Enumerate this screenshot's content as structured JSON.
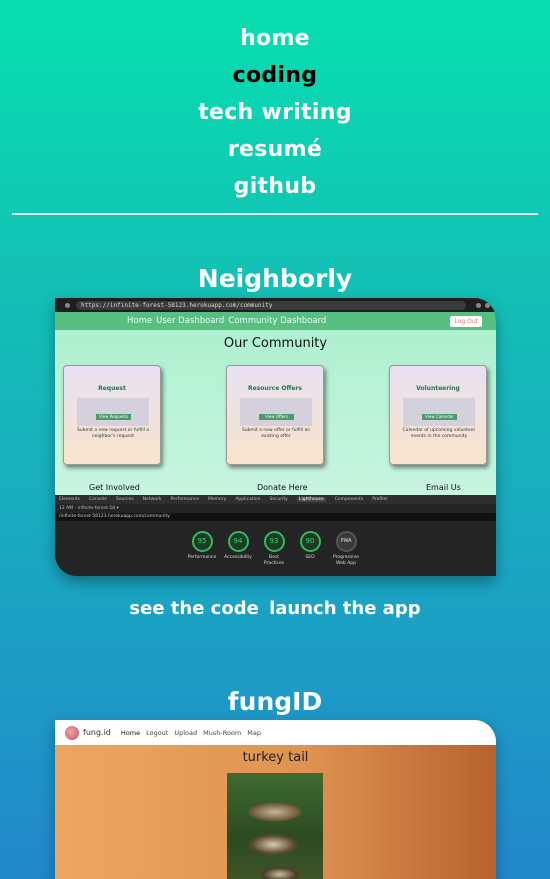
{
  "nav": {
    "items": [
      "home",
      "coding",
      "tech writing",
      "resumé",
      "github"
    ],
    "active": "coding"
  },
  "projects": [
    {
      "title": "Neighborly",
      "screenshot": {
        "url": "https://infinite-forest-58123.herokuapp.com/community",
        "nav_links": [
          "Home",
          "User Dashboard",
          "Community Dashboard"
        ],
        "logout": "Log Out",
        "heading": "Our Community",
        "cards": [
          {
            "title": "Request",
            "button": "View Requests",
            "desc": "Submit a new request or fulfill a neighbor's request"
          },
          {
            "title": "Resource Offers",
            "button": "View Offers",
            "desc": "Submit a new offer or fulfill an existing offer"
          },
          {
            "title": "Volunteering",
            "button": "View Calendar",
            "desc": "Calendar of upcoming volunteer events in the community"
          }
        ],
        "footer": [
          "Get Involved",
          "Donate Here",
          "Email Us"
        ],
        "devtools_tabs": [
          "Elements",
          "Console",
          "Sources",
          "Network",
          "Performance",
          "Memory",
          "Application",
          "Security",
          "Lighthouse",
          "Components",
          "Profiler"
        ],
        "devtools_row": "12 AM - infinite-forest-58 ▾",
        "devtools_url": "/infinite-forest-58123.herokuapp.com/community",
        "scores": [
          {
            "value": "95",
            "label": "Performance"
          },
          {
            "value": "94",
            "label": "Accessibility"
          },
          {
            "value": "93",
            "label": "Best Practices"
          },
          {
            "value": "90",
            "label": "SEO"
          },
          {
            "value": "PWA",
            "label": "Progressive Web App"
          }
        ]
      },
      "links": [
        "see the code",
        "launch the app"
      ]
    },
    {
      "title": "fungID",
      "screenshot": {
        "brand": "fung.id",
        "nav_links": [
          "Home",
          "Logout",
          "Upload",
          "Mush-Room",
          "Map"
        ],
        "heading": "turkey tail"
      }
    }
  ]
}
